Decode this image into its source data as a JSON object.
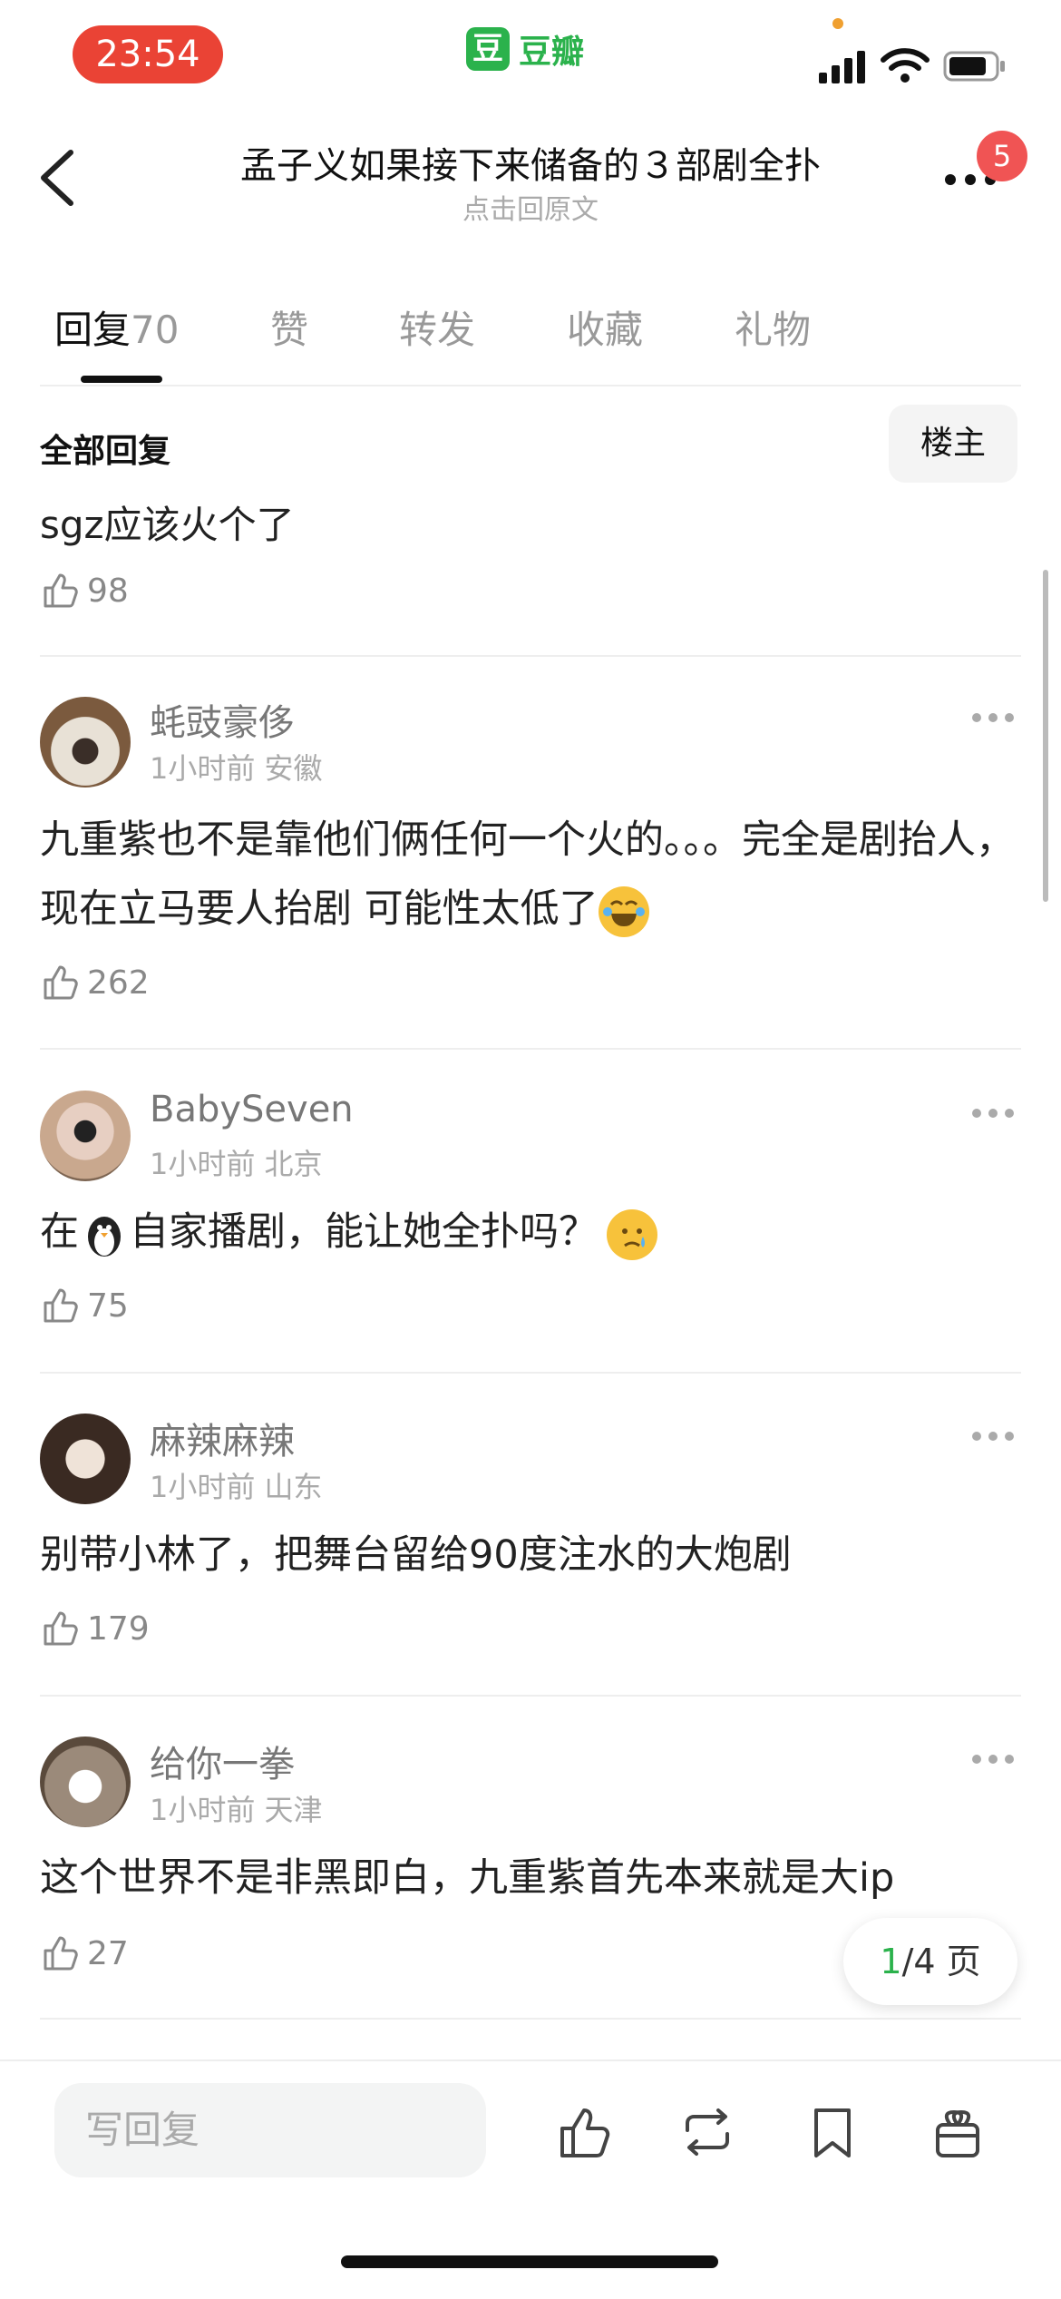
{
  "status": {
    "time": "23:54",
    "app_logo": "豆",
    "app_name": "豆瓣"
  },
  "header": {
    "title": "孟子义如果接下来储备的３部剧全扑",
    "subtitle": "点击回原文",
    "badge": "5"
  },
  "tabs": [
    {
      "label": "回复",
      "count": "70"
    },
    {
      "label": "赞"
    },
    {
      "label": "转发"
    },
    {
      "label": "收藏"
    },
    {
      "label": "礼物"
    }
  ],
  "filter": {
    "title": "全部回复",
    "owner_button": "楼主"
  },
  "prev_comment": {
    "text_tail": "sgz应该火个了",
    "likes": "98"
  },
  "comments": [
    {
      "user": "蚝豉豪侈",
      "time": "1小时前",
      "location": "安徽",
      "text": "九重紫也不是靠他们俩任何一个火的。。。完全是剧抬人，现在立马要人抬剧 可能性太低了",
      "emoji": "joy-emoji",
      "likes": "262"
    },
    {
      "user": "BabySeven",
      "time": "1小时前",
      "location": "北京",
      "text_before": "在",
      "text_after": "自家播剧，能让她全扑吗？",
      "emoji": "crying-emoji",
      "likes": "75"
    },
    {
      "user": "麻辣麻辣",
      "time": "1小时前",
      "location": "山东",
      "text": "别带小林了，把舞台留给90度注水的大炮剧",
      "likes": "179"
    },
    {
      "user": "给你一拳",
      "time": "1小时前",
      "location": "天津",
      "text": "这个世界不是非黑即白，九重紫首先本来就是大ip",
      "likes": "27"
    }
  ],
  "pager": {
    "current": "1",
    "total": "/4 页"
  },
  "bottom": {
    "reply_placeholder": "写回复"
  },
  "colors": {
    "brand": "#2bb24c",
    "badge": "#f05454",
    "time_pill": "#ea4335"
  }
}
